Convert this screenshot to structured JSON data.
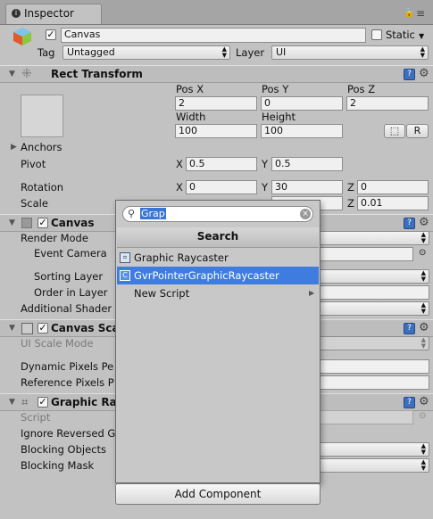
{
  "tab": {
    "title": "Inspector"
  },
  "object": {
    "name": "Canvas",
    "static_label": "Static",
    "tag_label": "Tag",
    "tag_value": "Untagged",
    "layer_label": "Layer",
    "layer_value": "UI"
  },
  "rect_transform": {
    "title": "Rect Transform",
    "pos_x_label": "Pos X",
    "pos_y_label": "Pos Y",
    "pos_z_label": "Pos Z",
    "pos_x": "2",
    "pos_y": "0",
    "pos_z": "2",
    "width_label": "Width",
    "height_label": "Height",
    "width": "100",
    "height": "100",
    "raw_button": "R",
    "anchors_label": "Anchors",
    "pivot_label": "Pivot",
    "pivot_x_label": "X",
    "pivot_x": "0.5",
    "pivot_y_label": "Y",
    "pivot_y": "0.5",
    "rotation_label": "Rotation",
    "rot_x_label": "X",
    "rot_x": "0",
    "rot_y_label": "Y",
    "rot_y": "30",
    "rot_z_label": "Z",
    "rot_z": "0",
    "scale_label": "Scale",
    "scale_z_label": "Z",
    "scale_z": "0.01"
  },
  "canvas": {
    "title": "Canvas",
    "render_mode": "Render Mode",
    "event_camera": "Event Camera",
    "sorting_layer": "Sorting Layer",
    "order_in_layer": "Order in Layer",
    "additional_shader": "Additional Shader"
  },
  "canvas_scaler": {
    "title": "Canvas Sca",
    "ui_scale_mode": "UI Scale Mode",
    "dynamic_pixels": "Dynamic Pixels Pe",
    "reference_pixels": "Reference Pixels P"
  },
  "graphic_raycaster": {
    "title": "Graphic Ray",
    "script": "Script",
    "ignore_reversed": "Ignore Reversed G",
    "blocking_objects": "Blocking Objects",
    "blocking_mask": "Blocking Mask"
  },
  "popup": {
    "search_value": "Grap",
    "header": "Search",
    "items": [
      {
        "label": "Graphic Raycaster",
        "icon": "script-component-icon"
      },
      {
        "label": "GvrPointerGraphicRaycaster",
        "icon": "csharp-script-icon"
      },
      {
        "label": "New Script"
      }
    ]
  },
  "add_component": "Add Component"
}
